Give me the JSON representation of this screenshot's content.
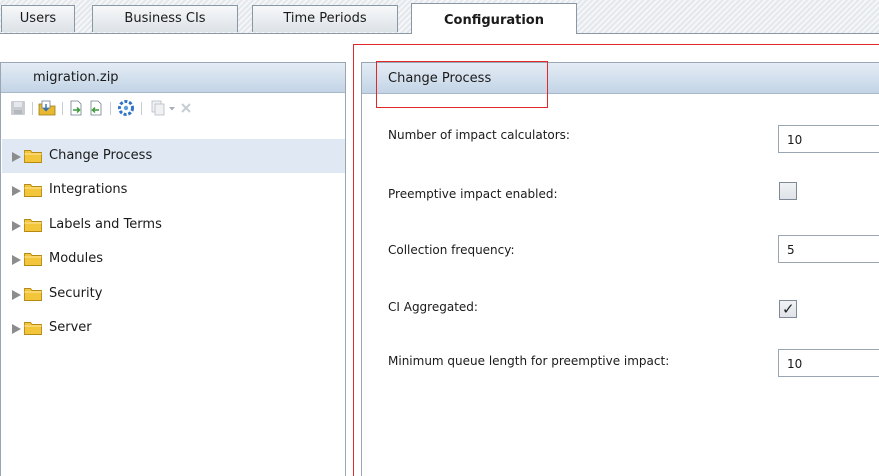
{
  "tabs": [
    {
      "label": "Users",
      "active": false
    },
    {
      "label": "Business CIs",
      "active": false
    },
    {
      "label": "Time Periods",
      "active": false
    },
    {
      "label": "Configuration",
      "active": true
    }
  ],
  "left_panel": {
    "title": "migration.zip",
    "toolbar_icons": [
      "save-icon",
      "import-icon",
      "export-icon",
      "export-selected-icon",
      "refresh-icon",
      "copy-icon",
      "dropdown-arrow-icon",
      "delete-icon"
    ],
    "tree": [
      {
        "label": "Change Process",
        "selected": true
      },
      {
        "label": "Integrations",
        "selected": false
      },
      {
        "label": "Labels and Terms",
        "selected": false
      },
      {
        "label": "Modules",
        "selected": false
      },
      {
        "label": "Security",
        "selected": false
      },
      {
        "label": "Server",
        "selected": false
      }
    ]
  },
  "right_panel": {
    "section_title": "Change Process",
    "fields": [
      {
        "label": "Number of impact calculators:",
        "type": "text",
        "value": "10"
      },
      {
        "label": "Preemptive impact enabled:",
        "type": "checkbox",
        "checked": false
      },
      {
        "label": "Collection frequency:",
        "type": "text",
        "value": "5"
      },
      {
        "label": "CI Aggregated:",
        "type": "checkbox",
        "checked": true
      },
      {
        "label": "Minimum queue length for preemptive impact:",
        "type": "text",
        "value": "10"
      }
    ]
  },
  "colors": {
    "annotation_red": "#e0282a",
    "header_blue": "#c3d4e6",
    "selected_row": "#dfe8f3",
    "folder_yellow": "#f3c53b"
  }
}
